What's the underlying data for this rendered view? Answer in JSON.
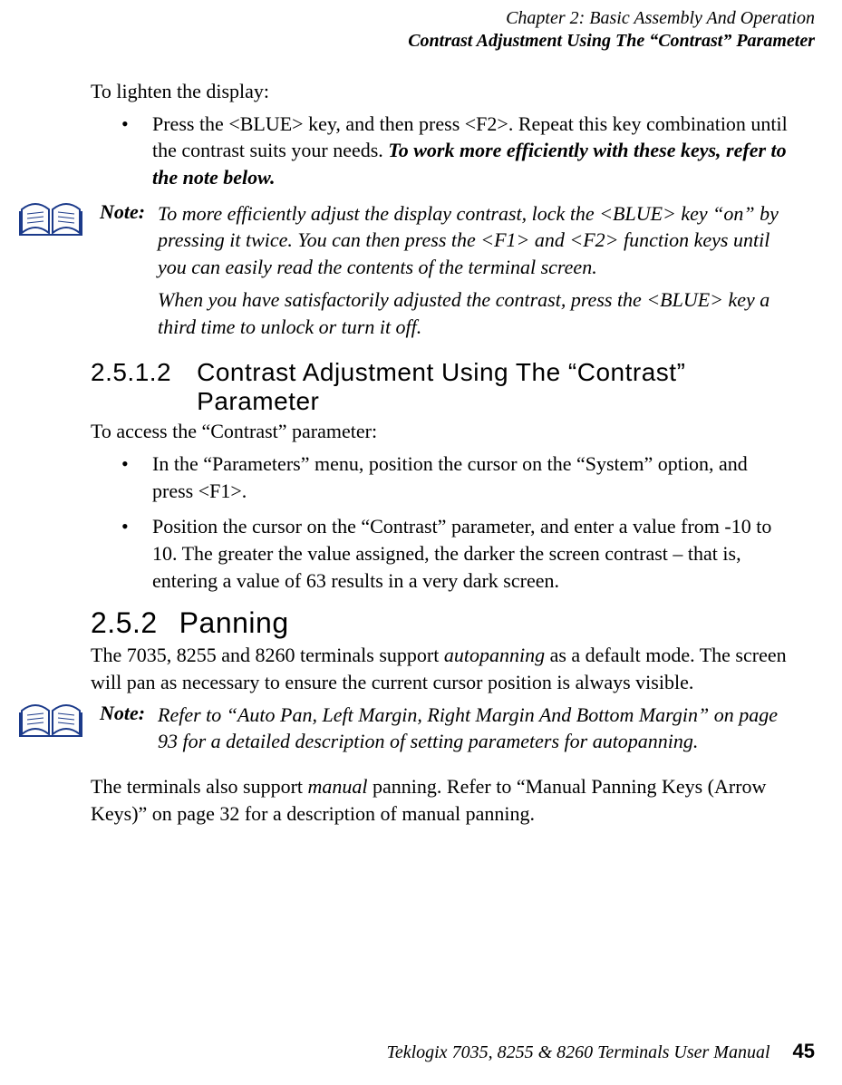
{
  "header": {
    "chapter_line": "Chapter  2:  Basic Assembly And Operation",
    "section_line": "Contrast Adjustment Using The “Contrast” Parameter"
  },
  "intro_lighten": "To lighten the display:",
  "bullets_lighten": [
    {
      "pre": "Press the <BLUE> key, and then press <F2>. Repeat this key combination until the contrast suits your needs. ",
      "emph": "To work more efficiently with these keys, refer to the note below."
    }
  ],
  "note1": {
    "label": "Note:",
    "p1": "To more efficiently adjust the display contrast, lock the <BLUE> key “on” by pressing it twice. You can then press the <F1> and <F2> function keys until you can easily read the contents of the terminal screen.",
    "p2": "When you have satisfactorily adjusted the contrast, press the <BLUE> key a third time to unlock or turn it off."
  },
  "h2512_num": "2.5.1.2",
  "h2512_title": "Contrast Adjustment Using The “Contrast” Parameter",
  "access_para": "To access the “Contrast” parameter:",
  "bullets_contrast": [
    "In the “Parameters” menu, position the cursor on the “System” option, and press <F1>.",
    "Position the cursor on the “Contrast” parameter, and enter a value from -10 to 10. The greater the value assigned, the darker the screen contrast – that is, entering a value of 63 results in a very dark screen."
  ],
  "h252_num": "2.5.2",
  "h252_title": "Panning",
  "panning_para_pre": "The 7035, 8255 and 8260 terminals support ",
  "panning_para_em": "autopanning",
  "panning_para_post": " as a default mode. The screen will pan as necessary to ensure the current cursor position is always visible.",
  "note2": {
    "label": "Note:",
    "body": "Refer to “Auto Pan, Left Margin, Right Margin And Bottom Margin” on page 93 for a detailed description of setting parameters for autopanning."
  },
  "manual_pre": "The terminals also support ",
  "manual_em": "manual",
  "manual_post": " panning. Refer to “Manual Panning Keys (Arrow Keys)” on page 32 for a description of manual panning.",
  "footer": {
    "title": "Teklogix 7035, 8255 & 8260 Terminals User Manual",
    "page": "45"
  },
  "glyphs": {
    "bullet": "•"
  }
}
